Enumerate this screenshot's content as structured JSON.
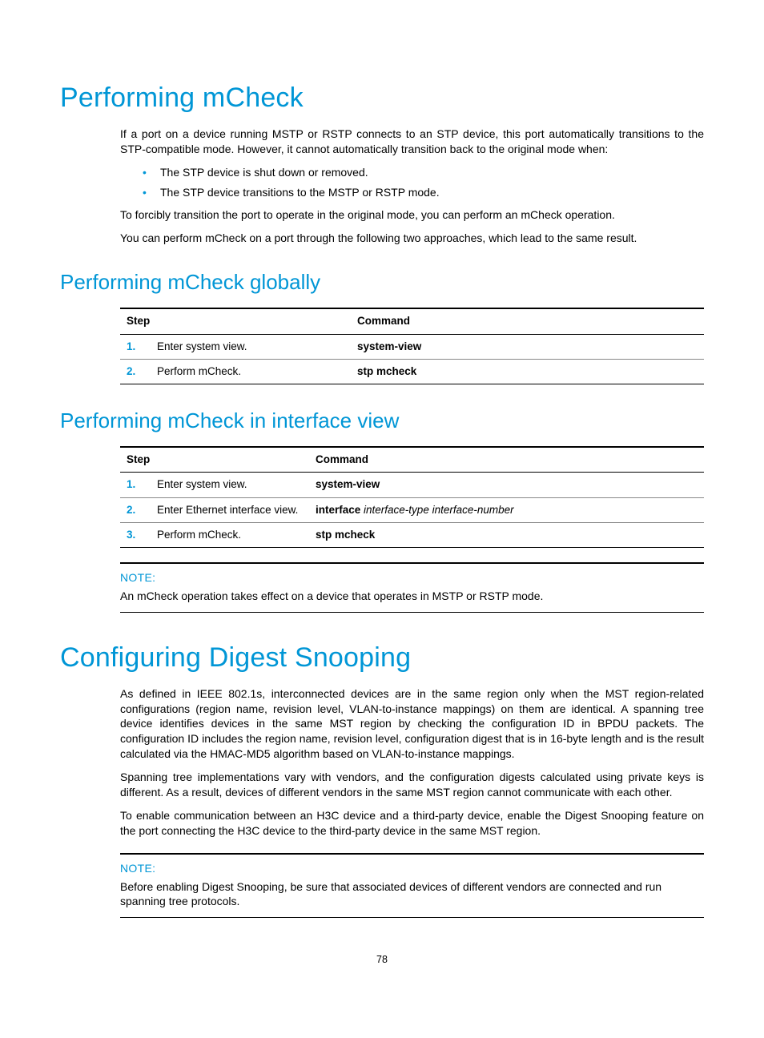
{
  "headings": {
    "h1_mcheck": "Performing mCheck",
    "h2_globally": "Performing mCheck globally",
    "h2_interface": "Performing mCheck in interface view",
    "h1_digest": "Configuring Digest Snooping"
  },
  "mcheck_intro": {
    "p1": "If a port on a device running MSTP or RSTP connects to an STP device, this port automatically transitions to the STP-compatible mode. However, it cannot automatically transition back to the original mode when:",
    "bullet1": "The STP device is shut down or removed.",
    "bullet2": "The STP device transitions to the MSTP or RSTP mode.",
    "p2": "To forcibly transition the port to operate in the original mode, you can perform an mCheck operation.",
    "p3": "You can perform mCheck on a port through the following two approaches, which lead to the same result."
  },
  "table_headers": {
    "step": "Step",
    "command": "Command"
  },
  "table1": {
    "r1": {
      "num": "1.",
      "step": "Enter system view.",
      "cmd_bold": "system-view"
    },
    "r2": {
      "num": "2.",
      "step": "Perform mCheck.",
      "cmd_bold": "stp mcheck"
    }
  },
  "table2": {
    "r1": {
      "num": "1.",
      "step": "Enter system view.",
      "cmd_bold": "system-view",
      "cmd_italic": ""
    },
    "r2": {
      "num": "2.",
      "step": "Enter Ethernet interface view.",
      "cmd_bold": "interface",
      "cmd_italic": " interface-type interface-number"
    },
    "r3": {
      "num": "3.",
      "step": "Perform mCheck.",
      "cmd_bold": "stp mcheck",
      "cmd_italic": ""
    }
  },
  "note1": {
    "label": "NOTE:",
    "text": "An mCheck operation takes effect on a device that operates in MSTP or RSTP mode."
  },
  "digest": {
    "p1": "As defined in IEEE 802.1s, interconnected devices are in the same region only when the MST region-related configurations (region name, revision level, VLAN-to-instance mappings) on them are identical. A spanning tree device identifies devices in the same MST region by checking the configuration ID in BPDU packets. The configuration ID includes the region name, revision level, configuration digest that is in 16-byte length and is the result calculated via the HMAC-MD5 algorithm based on VLAN-to-instance mappings.",
    "p2": "Spanning tree implementations vary with vendors, and the configuration digests calculated using private keys is different. As a result, devices of different vendors in the same MST region cannot communicate with each other.",
    "p3": "To enable communication between an H3C device and a third-party device, enable the Digest Snooping feature on the port connecting the H3C device to the third-party device in the same MST region."
  },
  "note2": {
    "label": "NOTE:",
    "text": "Before enabling Digest Snooping, be sure that associated devices of different vendors are connected and run spanning tree protocols."
  },
  "page_number": "78"
}
